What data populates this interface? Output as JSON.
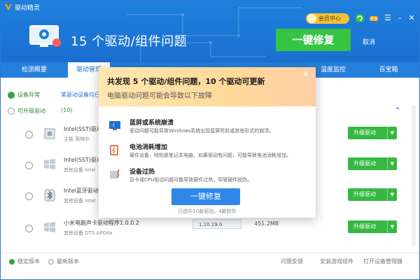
{
  "app": {
    "title": "驱动精灵",
    "member_label": "会员中心"
  },
  "hero": {
    "title": "15 个驱动/组件问题",
    "fix_button": "一键修复",
    "cancel_link": "取消"
  },
  "tabs": [
    {
      "label": "检测概要"
    },
    {
      "label": "驱动管理"
    },
    {
      "label": "温度监控"
    },
    {
      "label": "百宝箱"
    }
  ],
  "filters": {
    "abnormal": "设备异常",
    "abnormal_link": "某驱动设备均已检",
    "upgradable": "可升级驱动",
    "upgradable_count": "(10)"
  },
  "rows": [
    {
      "name": "Intel(SST)驱动",
      "sub": "主板     英特尔",
      "action": "升级驱动"
    },
    {
      "name": "Intel(SST)驱动",
      "sub": "其他设备   Intel",
      "action": "升级驱动"
    },
    {
      "name": "Intel蓝牙驱动",
      "sub": "其他设备   Intel",
      "action": "升级驱动"
    },
    {
      "name": "小米电脑声卡驱动程序1.0.0.2",
      "sub": "其他设备   DTS APO4x",
      "version": "1.10.19.0",
      "size": "451.2MB",
      "action": "升级驱动"
    }
  ],
  "footer": {
    "stable": "稳定版本",
    "latest": "最新版本",
    "feedback": "问题反馈",
    "install_game": "安装游戏组件",
    "open_devmgr": "打开设备管理器"
  },
  "modal": {
    "title": "共发现 5 个驱动/组件问题，10 个驱动可更新",
    "subtitle": "电脑驱动问题可能会导致以下故障",
    "items": [
      {
        "title": "蓝屏或系统崩溃",
        "desc": "驱动问题可能导致Windows系统出现蓝屏死机或其他形式的崩溃。"
      },
      {
        "title": "电池消耗增加",
        "desc": "硬件设备，特别是笔记本电脑，如果驱动有问题，可能导致电池消耗增加。"
      },
      {
        "title": "设备过热",
        "desc": "显卡或CPU驱动问题可能导致硬件过热，导致硬件损伤。"
      }
    ],
    "fix_button": "一键修复",
    "selected_text": "已选中10款驱动，4款软件"
  },
  "colors": {
    "primary": "#1f7fdc",
    "green": "#35c443",
    "modal_bg": "#ffe7b0"
  }
}
